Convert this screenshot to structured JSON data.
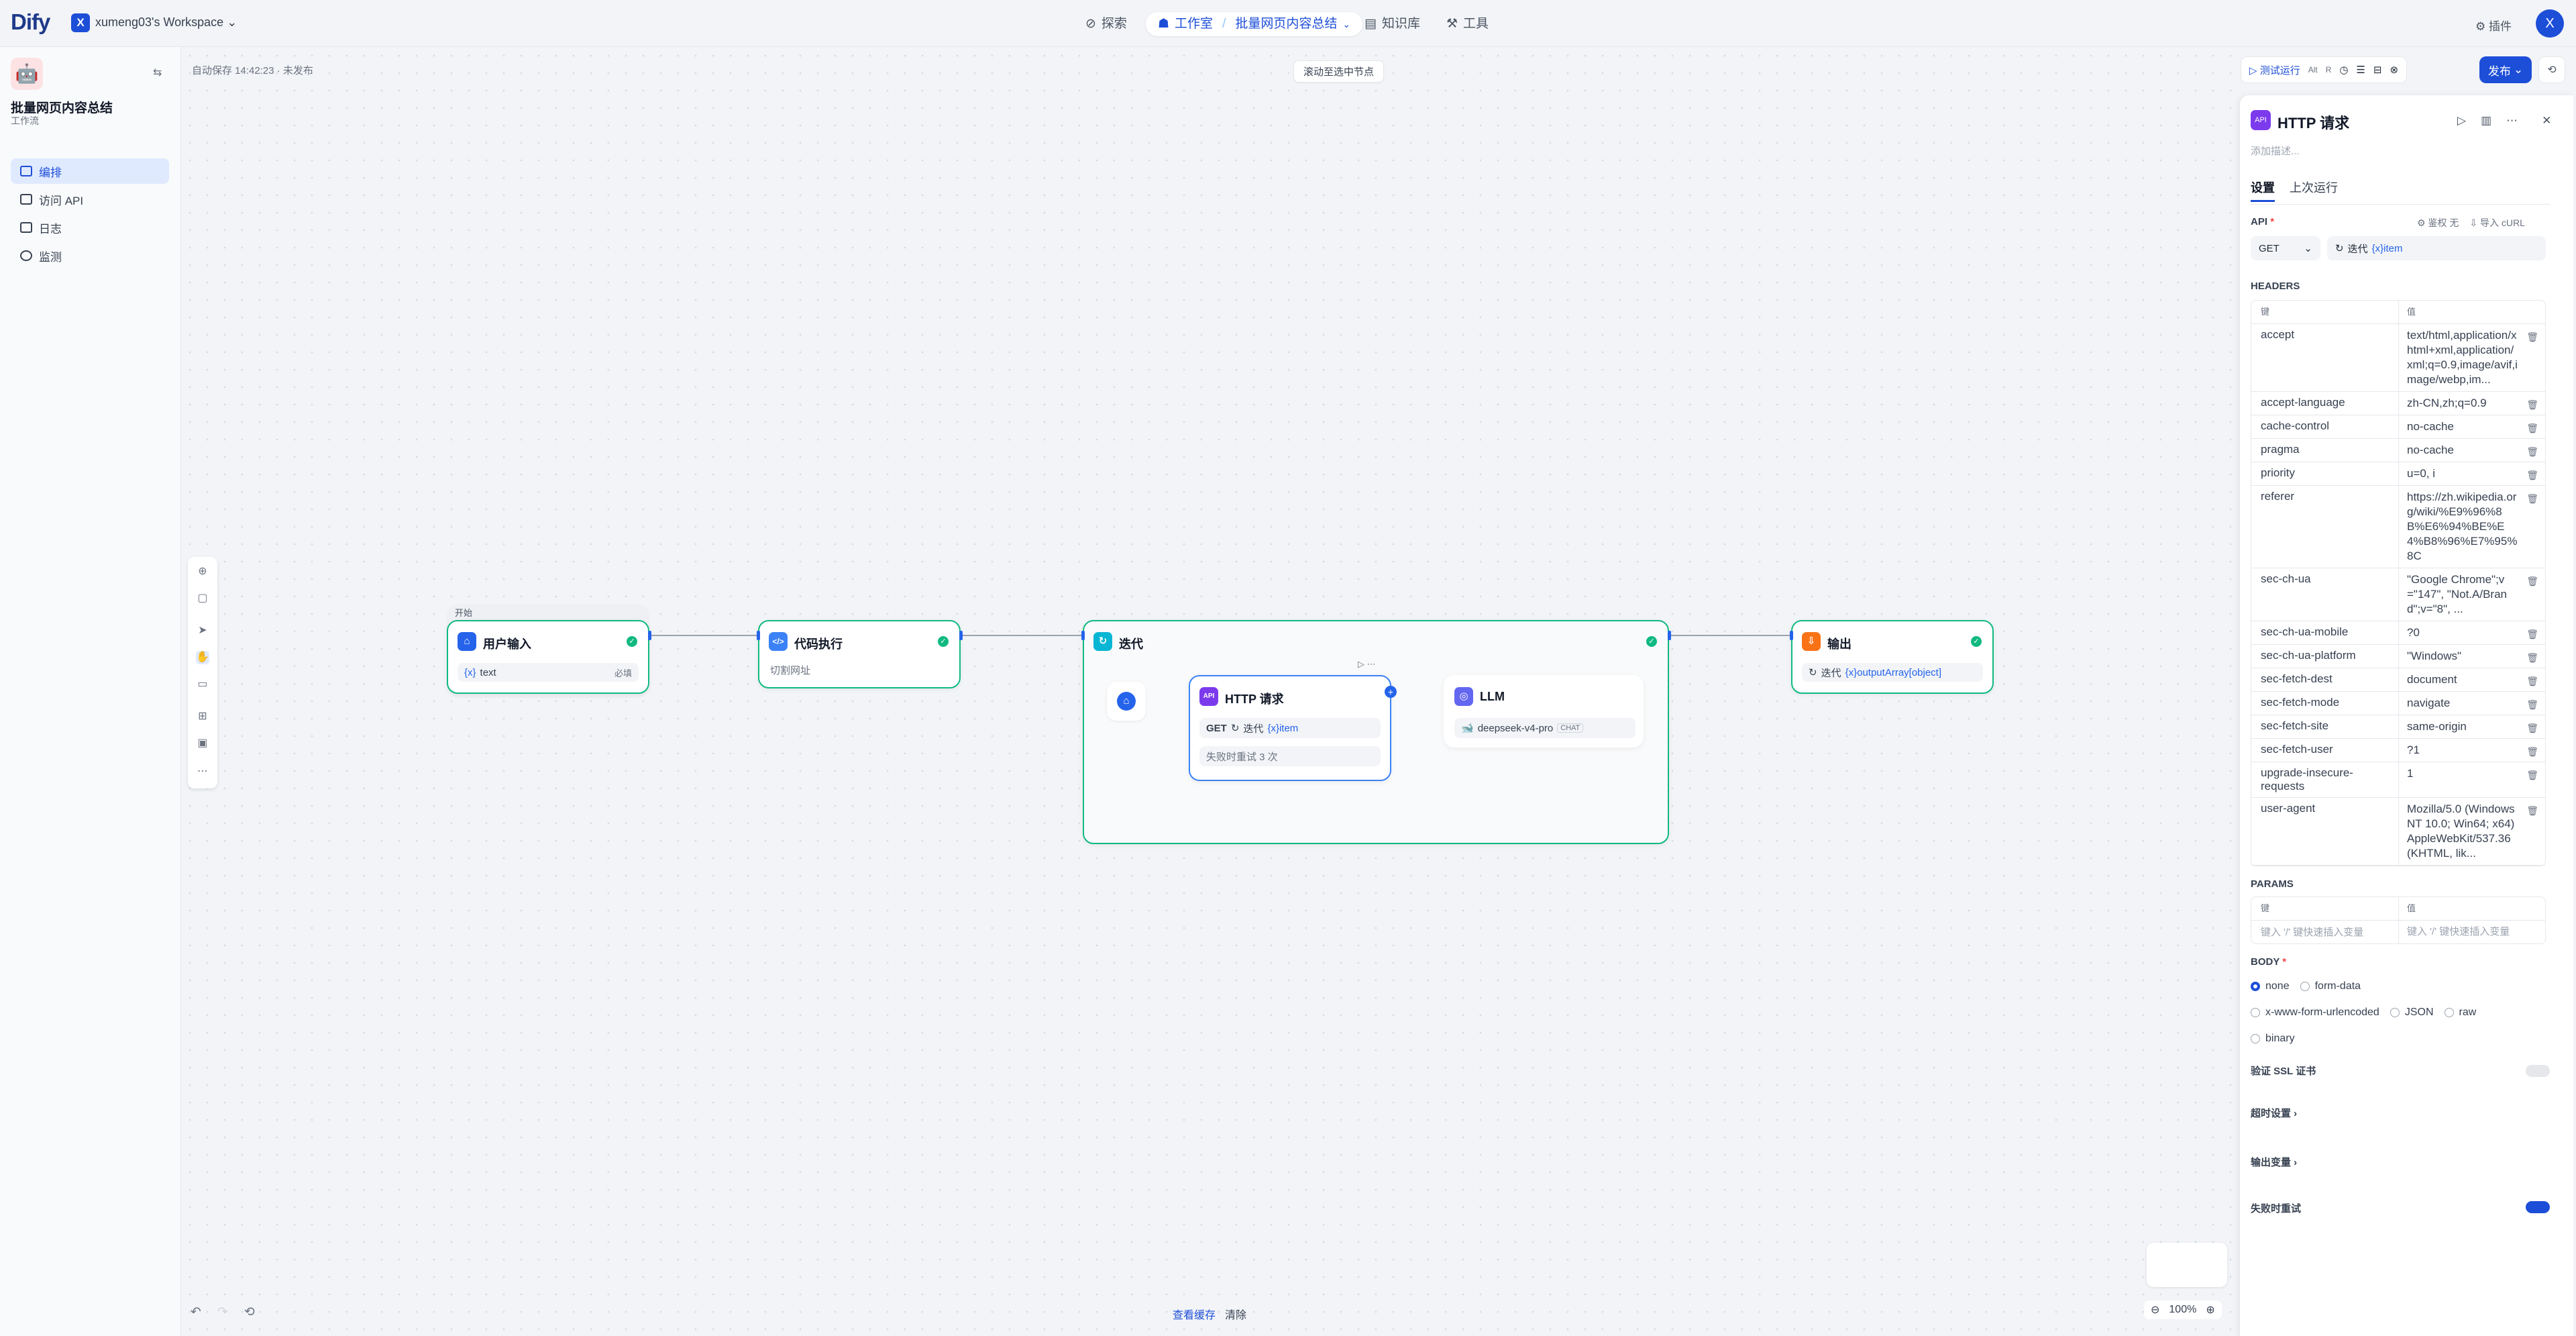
{
  "brand": {
    "logo": "Dify"
  },
  "workspace": {
    "initial": "X",
    "name": "xumeng03's Workspace"
  },
  "nav": {
    "explore": "探索",
    "studio": "工作室",
    "app": "批量网页内容总结",
    "knowledge": "知识库",
    "tools": "工具"
  },
  "header": {
    "plugins": "插件",
    "user_initial": "X"
  },
  "sidebar": {
    "app_title": "批量网页内容总结",
    "app_type": "工作流",
    "items": [
      {
        "label": "编排",
        "active": true
      },
      {
        "label": "访问 API"
      },
      {
        "label": "日志"
      },
      {
        "label": "监测"
      }
    ]
  },
  "canvas": {
    "autosave": "自动保存 14:42:23 · 未发布",
    "scroll_to_selected": "滚动至选中节点",
    "view_cache": "查看缓存",
    "clear": "清除",
    "zoom": "100%"
  },
  "nodes": {
    "start": {
      "tag": "开始",
      "title": "用户输入",
      "var_prefix": "{x}",
      "var": "text",
      "required": "必填"
    },
    "code": {
      "title": "代码执行",
      "desc": "切割网址"
    },
    "iteration": {
      "title": "迭代"
    },
    "http": {
      "title": "HTTP 请求",
      "method": "GET",
      "src": "迭代",
      "var": "{x}item",
      "retry": "失败时重试 3 次"
    },
    "llm": {
      "title": "LLM",
      "model": "deepseek-v4-pro",
      "mode": "CHAT"
    },
    "output": {
      "title": "输出",
      "src": "迭代",
      "var": "{x}outputArray[object]"
    }
  },
  "toolbar": {
    "test_run": "测试运行",
    "shortcut1": "Alt",
    "shortcut2": "R",
    "publish": "发布"
  },
  "panel": {
    "title": "HTTP 请求",
    "desc_placeholder": "添加描述...",
    "tabs": [
      "设置",
      "上次运行"
    ],
    "api_label": "API",
    "auth": "鉴权 无",
    "import_curl": "导入 cURL",
    "method": "GET",
    "url_src": "迭代",
    "url_var": "{x}item",
    "headers_label": "HEADERS",
    "col_key": "键",
    "col_val": "值",
    "headers": [
      {
        "k": "accept",
        "v": "text/html,application/xhtml+xml,application/xml;q=0.9,image/avif,image/webp,im..."
      },
      {
        "k": "accept-language",
        "v": "zh-CN,zh;q=0.9"
      },
      {
        "k": "cache-control",
        "v": "no-cache"
      },
      {
        "k": "pragma",
        "v": "no-cache"
      },
      {
        "k": "priority",
        "v": "u=0, i"
      },
      {
        "k": "referer",
        "v": "https://zh.wikipedia.org/wiki/%E9%96%8B%E6%94%BE%E4%B8%96%E7%95%8C"
      },
      {
        "k": "sec-ch-ua",
        "v": "\"Google Chrome\";v=\"147\", \"Not.A/Brand\";v=\"8\", ..."
      },
      {
        "k": "sec-ch-ua-mobile",
        "v": "?0"
      },
      {
        "k": "sec-ch-ua-platform",
        "v": "\"Windows\""
      },
      {
        "k": "sec-fetch-dest",
        "v": "document"
      },
      {
        "k": "sec-fetch-mode",
        "v": "navigate"
      },
      {
        "k": "sec-fetch-site",
        "v": "same-origin"
      },
      {
        "k": "sec-fetch-user",
        "v": "?1"
      },
      {
        "k": "upgrade-insecure-requests",
        "v": "1"
      },
      {
        "k": "user-agent",
        "v": "Mozilla/5.0 (Windows NT 10.0; Win64; x64) AppleWebKit/537.36 (KHTML, lik..."
      }
    ],
    "params_label": "PARAMS",
    "params_placeholder": "键入 '/' 键快速插入变量",
    "body_label": "BODY",
    "body_options": [
      "none",
      "form-data",
      "x-www-form-urlencoded",
      "JSON",
      "raw",
      "binary"
    ],
    "body_selected": "none",
    "ssl_label": "验证 SSL 证书",
    "timeout_label": "超时设置",
    "output_label": "输出变量",
    "retry_label": "失败时重试"
  }
}
